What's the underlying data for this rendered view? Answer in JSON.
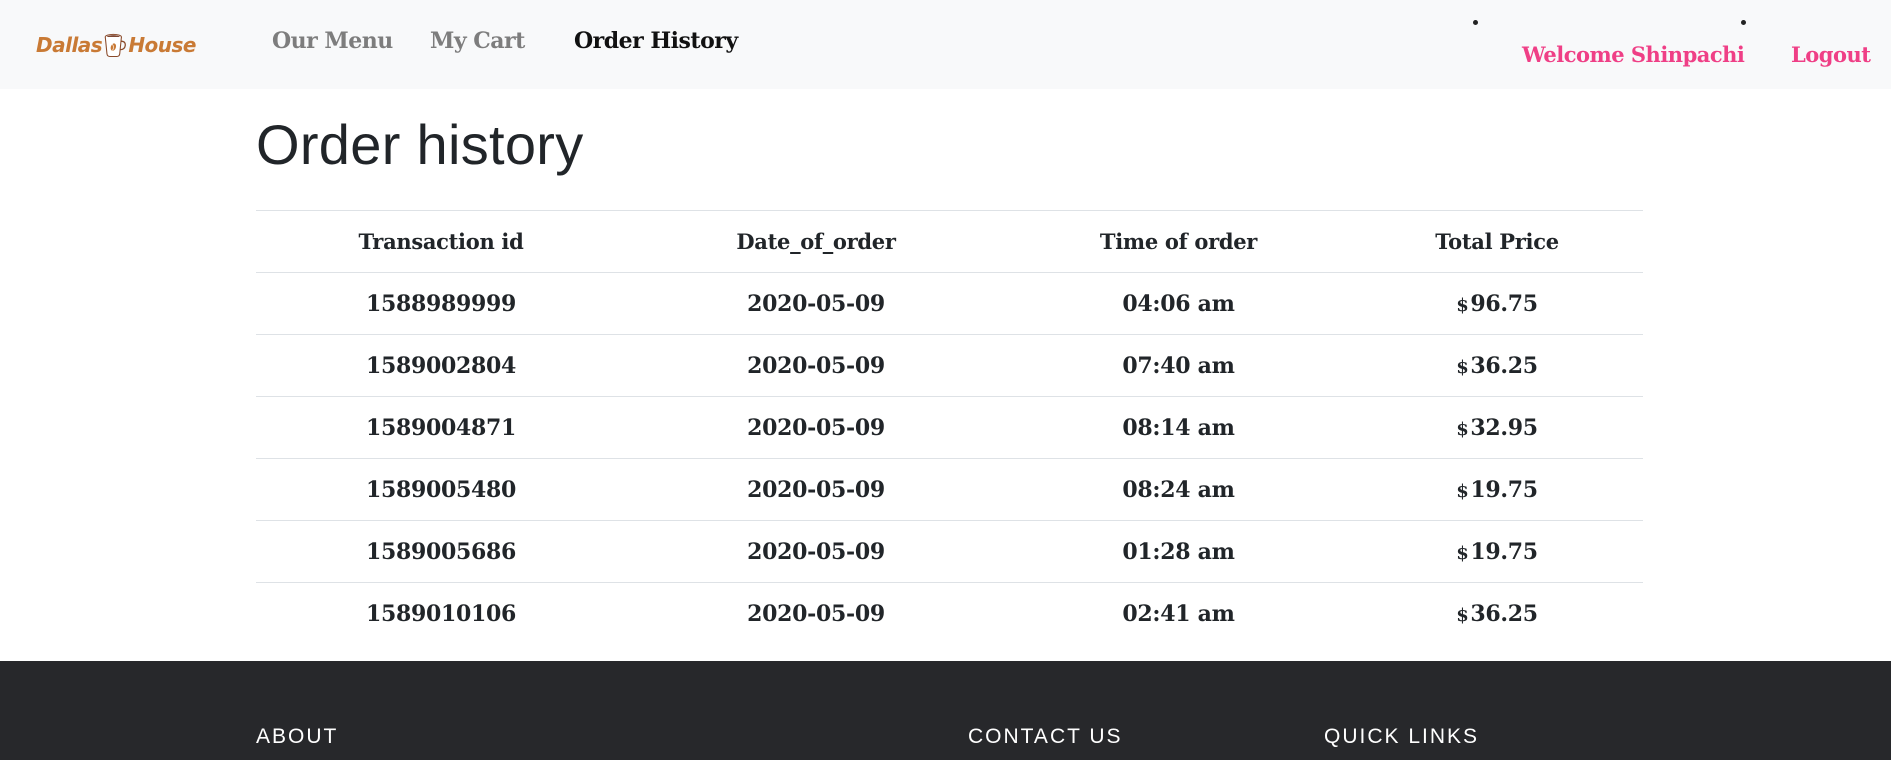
{
  "brand": {
    "word_left": "Dallas",
    "word_right": "House",
    "color": "#c97a35"
  },
  "nav": {
    "menu": "Our Menu",
    "cart": "My Cart",
    "history": "Order History",
    "welcome": "Welcome Shinpachi",
    "logout": "Logout",
    "accent": "#ef3f86"
  },
  "page": {
    "title": "Order history"
  },
  "orders": {
    "headers": [
      "Transaction id",
      "Date_of_order",
      "Time of order",
      "Total Price"
    ],
    "currency": "$",
    "rows": [
      {
        "id": "1588989999",
        "date": "2020-05-09",
        "time": "04:06 am",
        "price": "96.75"
      },
      {
        "id": "1589002804",
        "date": "2020-05-09",
        "time": "07:40 am",
        "price": "36.25"
      },
      {
        "id": "1589004871",
        "date": "2020-05-09",
        "time": "08:14 am",
        "price": "32.95"
      },
      {
        "id": "1589005480",
        "date": "2020-05-09",
        "time": "08:24 am",
        "price": "19.75"
      },
      {
        "id": "1589005686",
        "date": "2020-05-09",
        "time": "01:28 am",
        "price": "19.75"
      },
      {
        "id": "1589010106",
        "date": "2020-05-09",
        "time": "02:41 am",
        "price": "36.25"
      }
    ]
  },
  "footer": {
    "about": "ABOUT",
    "contact": "CONTACT US",
    "quick_links": "QUICK LINKS",
    "background": "#27282b"
  }
}
